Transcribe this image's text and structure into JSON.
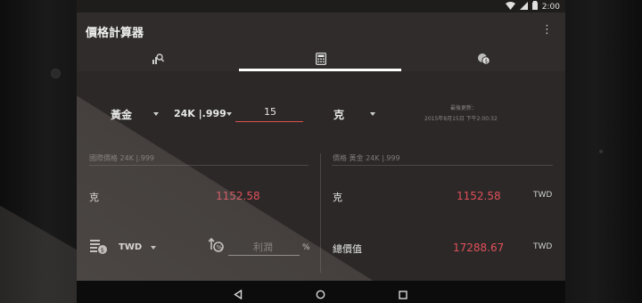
{
  "status": {
    "time": "2:00",
    "icons": [
      "wifi-icon",
      "signal-icon",
      "battery-icon"
    ]
  },
  "app": {
    "title": "價格計算器"
  },
  "tabs": [
    {
      "name": "tab-chart",
      "icon": "chart-search-icon"
    },
    {
      "name": "tab-calculator",
      "icon": "calculator-icon",
      "selected": true
    },
    {
      "name": "tab-currency",
      "icon": "currency-icon"
    }
  ],
  "calculator": {
    "metal": "黃金",
    "purity": "24K |.999",
    "quantity": "15",
    "unit": "克",
    "last_update_label": "最後更新：",
    "last_update_value": "2015年8月15日 下午2:00:32",
    "intl_price_label": "國際價格 24K |.999",
    "price_label": "價格  黃金  24K |.999",
    "left_unit": "克",
    "left_value": "1152.58",
    "right_unit": "克",
    "right_value": "1152.58",
    "currency_right": "TWD",
    "currency_select": "TWD",
    "profit_placeholder": "利潤",
    "percent": "%",
    "total_label": "總價值",
    "total_value": "17288.67",
    "total_currency": "TWD"
  },
  "colors": {
    "value_red": "#e0505a",
    "accent_line": "#d9534f"
  }
}
